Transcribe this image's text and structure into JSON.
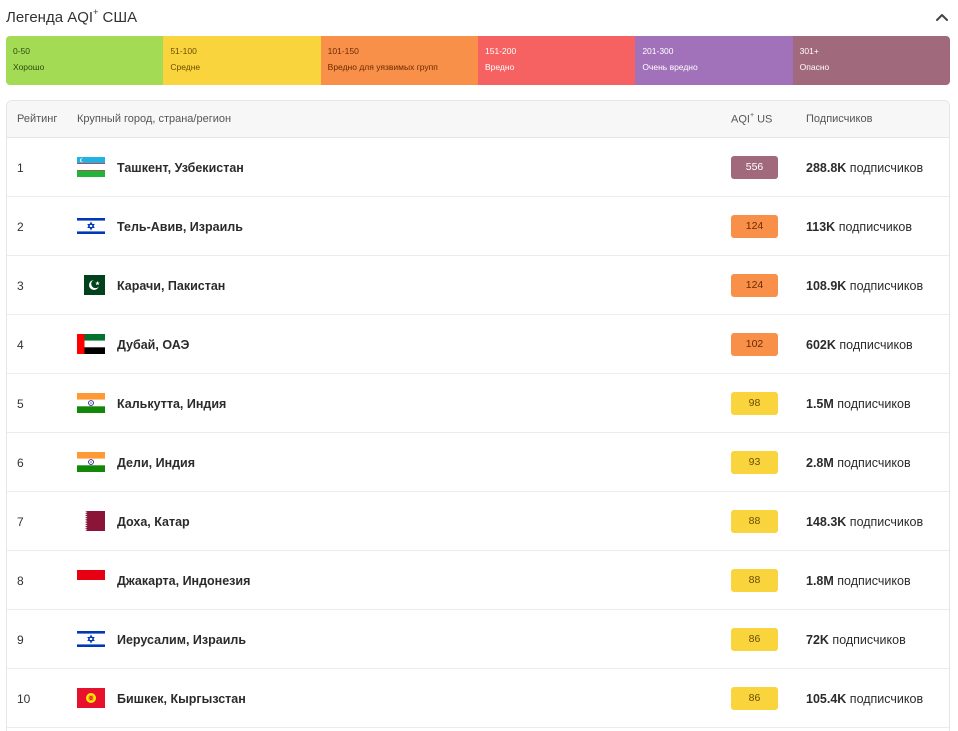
{
  "legend": {
    "title": "Легенда AQI",
    "title_sup": "+",
    "title_suffix": " США",
    "segments": [
      {
        "range": "0-50",
        "label": "Хорошо",
        "color": "#a3dc54",
        "text": "#2f4a10"
      },
      {
        "range": "51-100",
        "label": "Средне",
        "color": "#fad43d",
        "text": "#6b4d00"
      },
      {
        "range": "101-150",
        "label": "Вредно для уязвимых групп",
        "color": "#f99049",
        "text": "#6a2a00"
      },
      {
        "range": "151-200",
        "label": "Вредно",
        "color": "#f66162",
        "text": "#ffffff"
      },
      {
        "range": "201-300",
        "label": "Очень вредно",
        "color": "#a171b9",
        "text": "#ffffff"
      },
      {
        "range": "301+",
        "label": "Опасно",
        "color": "#a06a7c",
        "text": "#ffffff"
      }
    ]
  },
  "table": {
    "headers": {
      "rank": "Рейтинг",
      "city": "Крупный город, страна/регион",
      "aqi": "AQI",
      "aqi_sup": "+",
      "aqi_suffix": " US",
      "subs": "Подписчиков"
    },
    "subs_word": "подписчиков",
    "rows": [
      {
        "rank": "1",
        "city": "Ташкент, Узбекистан",
        "flag": "uzbekistan-flag-icon",
        "aqi": "556",
        "aqi_color": "#a06a7c",
        "aqi_text": "#ffffff",
        "subs": "288.8K"
      },
      {
        "rank": "2",
        "city": "Тель-Авив, Израиль",
        "flag": "israel-flag-icon",
        "aqi": "124",
        "aqi_color": "#f99049",
        "aqi_text": "#6a2a00",
        "subs": "113K"
      },
      {
        "rank": "3",
        "city": "Карачи, Пакистан",
        "flag": "pakistan-flag-icon",
        "aqi": "124",
        "aqi_color": "#f99049",
        "aqi_text": "#6a2a00",
        "subs": "108.9K"
      },
      {
        "rank": "4",
        "city": "Дубай, ОАЭ",
        "flag": "uae-flag-icon",
        "aqi": "102",
        "aqi_color": "#f99049",
        "aqi_text": "#6a2a00",
        "subs": "602K"
      },
      {
        "rank": "5",
        "city": "Калькутта, Индия",
        "flag": "india-flag-icon",
        "aqi": "98",
        "aqi_color": "#fad43d",
        "aqi_text": "#6b4d00",
        "subs": "1.5M"
      },
      {
        "rank": "6",
        "city": "Дели, Индия",
        "flag": "india-flag-icon",
        "aqi": "93",
        "aqi_color": "#fad43d",
        "aqi_text": "#6b4d00",
        "subs": "2.8M"
      },
      {
        "rank": "7",
        "city": "Доха, Катар",
        "flag": "qatar-flag-icon",
        "aqi": "88",
        "aqi_color": "#fad43d",
        "aqi_text": "#6b4d00",
        "subs": "148.3K"
      },
      {
        "rank": "8",
        "city": "Джакарта, Индонезия",
        "flag": "indonesia-flag-icon",
        "aqi": "88",
        "aqi_color": "#fad43d",
        "aqi_text": "#6b4d00",
        "subs": "1.8M"
      },
      {
        "rank": "9",
        "city": "Иерусалим, Израиль",
        "flag": "israel-flag-icon",
        "aqi": "86",
        "aqi_color": "#fad43d",
        "aqi_text": "#6b4d00",
        "subs": "72K"
      },
      {
        "rank": "10",
        "city": "Бишкек, Кыргызстан",
        "flag": "kyrgyzstan-flag-icon",
        "aqi": "86",
        "aqi_color": "#fad43d",
        "aqi_text": "#6b4d00",
        "subs": "105.4K"
      }
    ]
  }
}
